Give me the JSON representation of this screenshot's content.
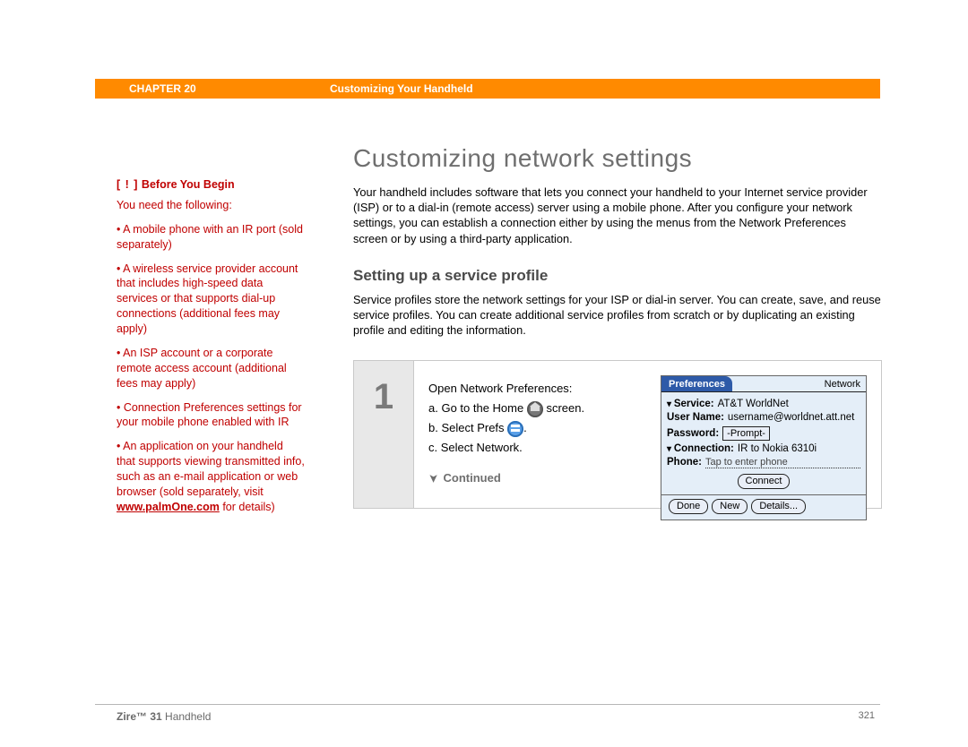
{
  "header": {
    "chapter_label": "CHAPTER 20",
    "chapter_title": "Customizing Your Handheld"
  },
  "sidebar": {
    "byb_marker": "[ ! ]",
    "byb_title": "Before You Begin",
    "intro": "You need the following:",
    "items": [
      "A mobile phone with an IR port (sold separately)",
      "A wireless service provider account that includes high-speed data services or that supports dial-up connections (additional fees may apply)",
      "An ISP account or a corporate remote access account (additional fees may apply)",
      "Connection Preferences settings for your mobile phone enabled with IR"
    ],
    "last_item_pre": "An application on your handheld that supports viewing transmitted info, such as an e-mail application or web browser (sold separately, visit ",
    "last_item_link": "www.palmOne.com",
    "last_item_post": " for details)"
  },
  "main": {
    "title": "Customizing network settings",
    "intro": "Your handheld includes software that lets you connect your handheld to your Internet service provider (ISP) or to a dial-in (remote access) server using a mobile phone. After you configure your network settings, you can establish a connection either by using the menus from the Network Preferences screen or by using a third-party application.",
    "subtitle": "Setting up a service profile",
    "sub_intro": "Service profiles store the network settings for your ISP or dial-in server. You can create, save, and reuse service profiles. You can create additional service profiles from scratch or by duplicating an existing profile and editing the information."
  },
  "step": {
    "number": "1",
    "heading": "Open Network Preferences:",
    "a_pre": "a.  Go to the Home ",
    "a_post": " screen.",
    "b_pre": "b.  Select Prefs ",
    "b_post": ".",
    "c": "c.  Select Network.",
    "continued": "Continued"
  },
  "palm": {
    "title": "Preferences",
    "category": "Network",
    "service_label": "Service:",
    "service_value": "AT&T WorldNet",
    "username_label": "User Name:",
    "username_value": "username@worldnet.att.net",
    "password_label": "Password:",
    "password_value": "-Prompt-",
    "connection_label": "Connection:",
    "connection_value": "IR to Nokia 6310i",
    "phone_label": "Phone:",
    "phone_value": "Tap to enter phone",
    "connect_btn": "Connect",
    "done_btn": "Done",
    "new_btn": "New",
    "details_btn": "Details..."
  },
  "footer": {
    "product_bold": "Zire™ 31",
    "product_rest": " Handheld",
    "page": "321"
  }
}
